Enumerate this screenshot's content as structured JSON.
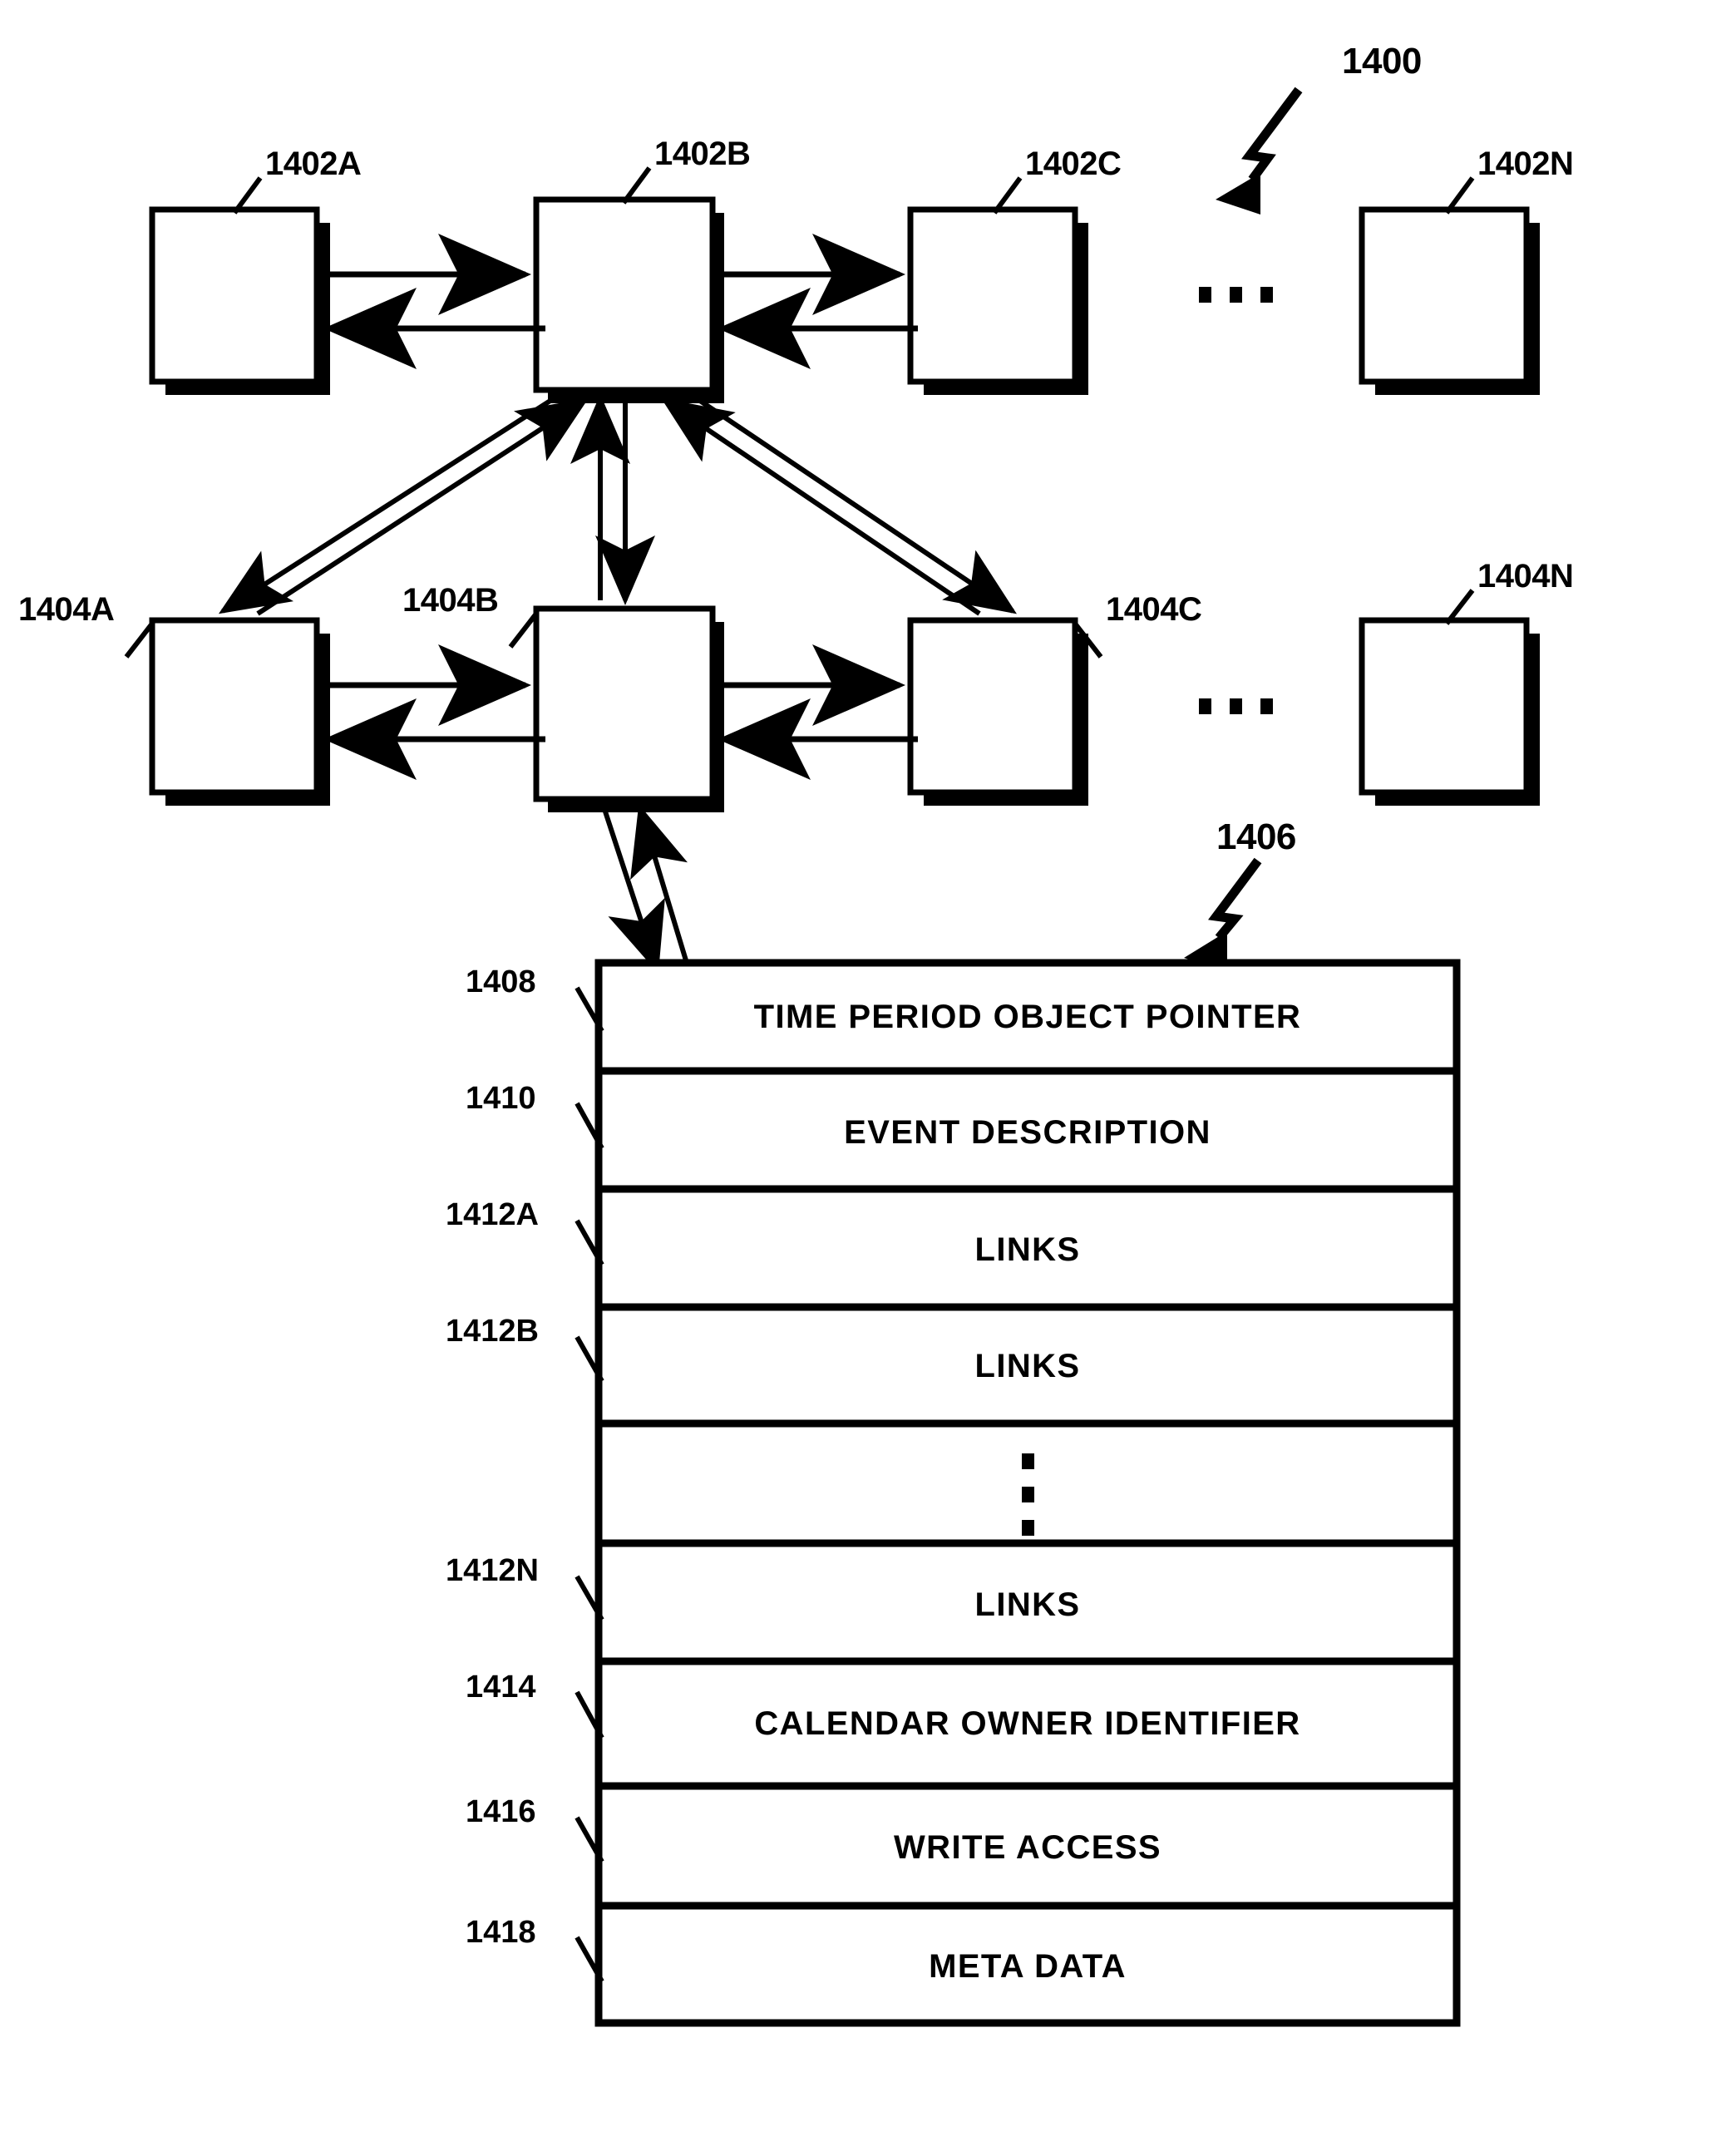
{
  "figure": {
    "number": "1400",
    "detail_number": "1406",
    "top_row": {
      "nodes": [
        {
          "ref": "1402A"
        },
        {
          "ref": "1402B"
        },
        {
          "ref": "1402C"
        },
        {
          "ref": "1402N"
        }
      ],
      "ellipsis": "..."
    },
    "bottom_row": {
      "nodes": [
        {
          "ref": "1404A"
        },
        {
          "ref": "1404B"
        },
        {
          "ref": "1404C"
        },
        {
          "ref": "1404N"
        }
      ],
      "ellipsis": "..."
    },
    "record": {
      "rows": [
        {
          "ref": "1408",
          "label": "TIME PERIOD OBJECT POINTER"
        },
        {
          "ref": "1410",
          "label": "EVENT DESCRIPTION"
        },
        {
          "ref": "1412A",
          "label": "LINKS"
        },
        {
          "ref": "1412B",
          "label": "LINKS"
        },
        {
          "ref": "",
          "label": ""
        },
        {
          "ref": "1412N",
          "label": "LINKS"
        },
        {
          "ref": "1414",
          "label": "CALENDAR OWNER IDENTIFIER"
        },
        {
          "ref": "1416",
          "label": "WRITE ACCESS"
        },
        {
          "ref": "1418",
          "label": "META DATA"
        }
      ]
    }
  },
  "colors": {
    "ink": "#000000",
    "paper": "#ffffff"
  }
}
